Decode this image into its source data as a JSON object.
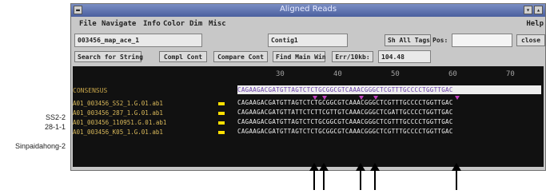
{
  "window": {
    "title": "Aligned Reads"
  },
  "menu": {
    "items": [
      "File",
      "Navigate",
      "Info",
      "Color",
      "Dim",
      "Misc"
    ],
    "help": "Help"
  },
  "toolbar": {
    "file_field": "003456_map_ace_1",
    "contig_field": "Contig1",
    "show_tags_button": "Sh All Tags",
    "pos_label": "Pos:",
    "pos_value": "",
    "close_button": "close",
    "search_button": "Search for String",
    "compl_cont_button": "Compl Cont",
    "compare_cont_button": "Compare Cont",
    "find_main_win_button": "Find Main Win",
    "err_label": "Err/10kb:",
    "err_value": "104.48"
  },
  "ruler": {
    "ticks": [
      "30",
      "40",
      "50",
      "60",
      "70"
    ]
  },
  "alignment": {
    "consensus_label": "CONSENSUS",
    "consensus_seq": "CAGAAGACGATGTTAGTCTCTGCGGCGTCAAACGGGCTCGTTTGCCCCTGGTTGAC",
    "reads": [
      {
        "name": "A01_003456_SS2_1.G.01.ab1",
        "seq": "CAGAAGACGATGTTAGTCTCTGCGGCGTCAAACGGGCTCGTTTGCCCCTGGTTGAC"
      },
      {
        "name": "A01_003456_287_1.G.01.ab1",
        "seq": "CAGAAGACGATGTTATTCTCTTCGTTGTCAAACGGGCTCGATTGCCCCTGGTTGAC"
      },
      {
        "name": "A01_003456_110951.G.01.ab1",
        "seq": "CAGAAGACGATGTTAGTCTCTGCGGCGTCAAACGGGCTCGTTTGCCCCTGGTTGAC"
      },
      {
        "name": "A01_003456_K05_1.G.01.ab1",
        "seq": "CAGAAGACGATGTTAGTCTCTGCGGCGTCAAACGGGCTCGTTTGCCCCTGGTTGAC"
      }
    ]
  },
  "external_labels": [
    "SS2-2",
    "28-1-1",
    "Sinpaidahong-2"
  ]
}
